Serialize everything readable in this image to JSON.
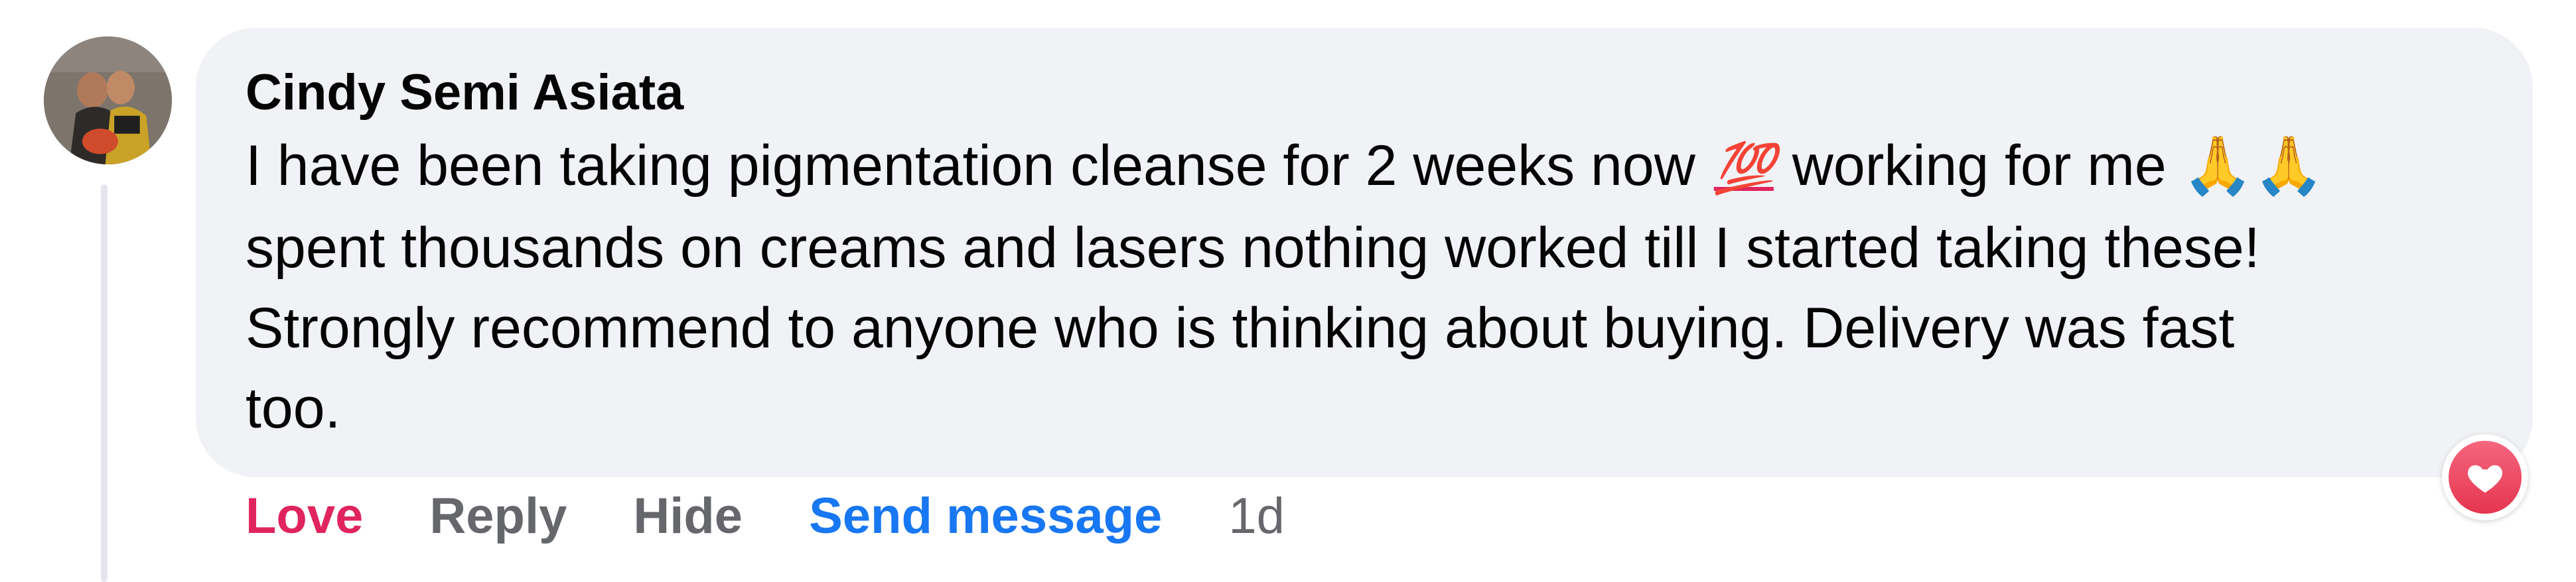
{
  "comment": {
    "author": "Cindy Semi Asiata",
    "lines": [
      {
        "before": "I have been taking pigmentation cleanse for 2 weeks now ",
        "emoji_100": "💯",
        "after": " working for me ",
        "emoji_pray": "🙏🙏"
      },
      {
        "text": "spent thousands on creams and lasers nothing worked till I started taking these!"
      },
      {
        "text": "Strongly recommend to anyone who is thinking about buying. Delivery was fast"
      },
      {
        "text": "too."
      }
    ],
    "reaction_icon": "heart-love-icon"
  },
  "actions": {
    "love_label": "Love",
    "reply_label": "Reply",
    "hide_label": "Hide",
    "send_message_label": "Send message",
    "timestamp": "1d"
  },
  "colors": {
    "love": "#e0245e",
    "link": "#1877f2",
    "muted": "#65676b",
    "bubble": "#f0f2f5"
  }
}
